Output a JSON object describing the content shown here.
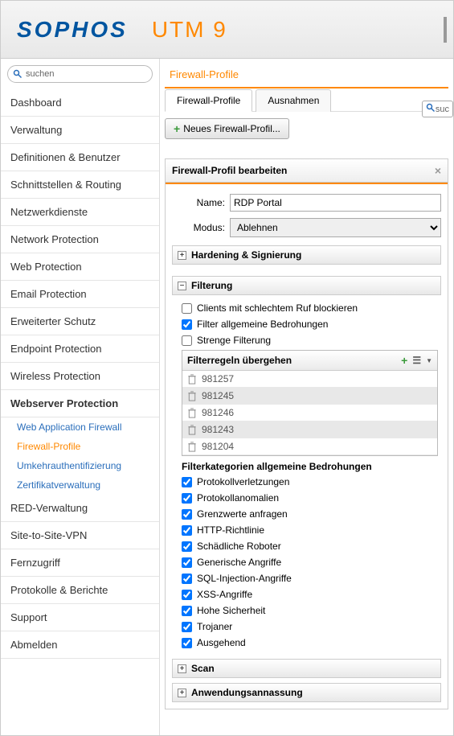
{
  "header": {
    "logo": "SOPHOS",
    "product": "UTM 9"
  },
  "search": {
    "placeholder": "suchen"
  },
  "nav": [
    "Dashboard",
    "Verwaltung",
    "Definitionen & Benutzer",
    "Schnittstellen & Routing",
    "Netzwerkdienste",
    "Network Protection",
    "Web Protection",
    "Email Protection",
    "Erweiterter Schutz",
    "Endpoint Protection",
    "Wireless Protection"
  ],
  "nav_active": "Webserver Protection",
  "subnav": {
    "waf": "Web Application Firewall",
    "fw": "Firewall-Profile",
    "rev": "Umkehrauthentifizierung",
    "cert": "Zertifikatverwaltung"
  },
  "nav_tail": [
    "RED-Verwaltung",
    "Site-to-Site-VPN",
    "Fernzugriff",
    "Protokolle & Berichte",
    "Support",
    "Abmelden"
  ],
  "breadcrumb": "Firewall-Profile",
  "tabs": {
    "profiles": "Firewall-Profile",
    "exceptions": "Ausnahmen"
  },
  "toolbar": {
    "new_profile": "Neues Firewall-Profil..."
  },
  "search_btn": "suc",
  "panel": {
    "title": "Firewall-Profil bearbeiten",
    "name_label": "Name:",
    "name_value": "RDP Portal",
    "mode_label": "Modus:",
    "mode_value": "Ablehnen",
    "hardening": "Hardening & Signierung",
    "filtering": "Filterung",
    "f_bad": "Clients mit schlechtem Ruf blockieren",
    "f_common": "Filter allgemeine Bedrohungen",
    "f_strict": "Strenge Filterung",
    "rules_title": "Filterregeln übergehen",
    "rules": [
      "981257",
      "981245",
      "981246",
      "981243",
      "981204"
    ],
    "cat_title": "Filterkategorien allgemeine Bedrohungen",
    "cats": [
      "Protokollverletzungen",
      "Protokollanomalien",
      "Grenzwerte anfragen",
      "HTTP-Richtlinie",
      "Schädliche Roboter",
      "Generische Angriffe",
      "SQL-Injection-Angriffe",
      "XSS-Angriffe",
      "Hohe Sicherheit",
      "Trojaner",
      "Ausgehend"
    ],
    "scan": "Scan",
    "appfit": "Anwendungsannassung"
  }
}
